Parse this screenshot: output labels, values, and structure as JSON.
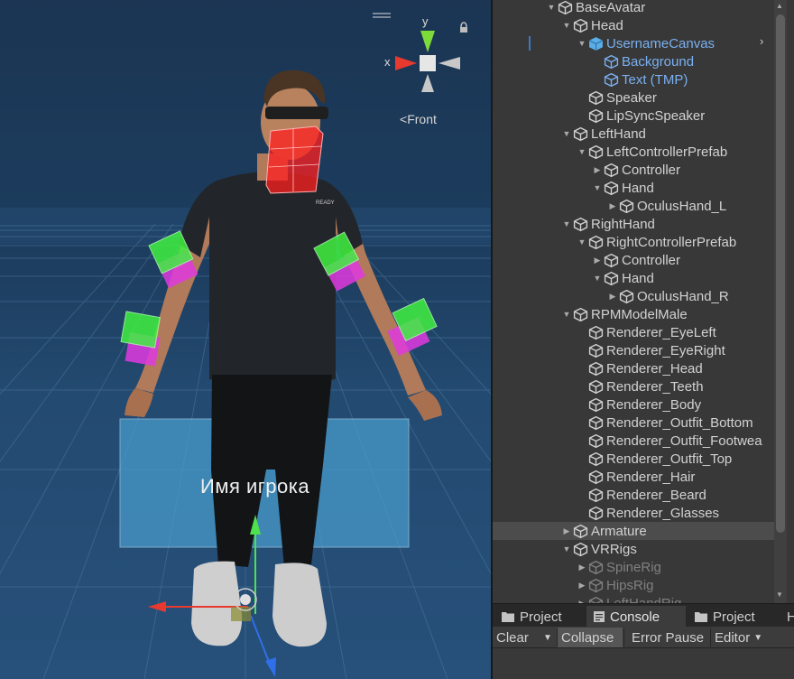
{
  "scene": {
    "orientation_label": "Front",
    "axis_y": "y",
    "axis_x": "x",
    "canvas_text": "Имя игрока",
    "lock_icon": "lock-icon",
    "menu_icon": "hamburger-icon"
  },
  "hierarchy": {
    "items": [
      {
        "label": "BaseAvatar",
        "fold": "open",
        "color": "normal"
      },
      {
        "label": "Head",
        "fold": "open",
        "color": "normal"
      },
      {
        "label": "UsernameCanvas",
        "fold": "open",
        "color": "blue",
        "icon": "prefab"
      },
      {
        "label": "Background",
        "fold": "none",
        "color": "blue"
      },
      {
        "label": "Text (TMP)",
        "fold": "none",
        "color": "blue"
      },
      {
        "label": "Speaker",
        "fold": "none",
        "color": "normal"
      },
      {
        "label": "LipSyncSpeaker",
        "fold": "none",
        "color": "normal"
      },
      {
        "label": "LeftHand",
        "fold": "open",
        "color": "normal"
      },
      {
        "label": "LeftControllerPrefab",
        "fold": "open",
        "color": "normal"
      },
      {
        "label": "Controller",
        "fold": "closed",
        "color": "normal"
      },
      {
        "label": "Hand",
        "fold": "open",
        "color": "normal"
      },
      {
        "label": "OculusHand_L",
        "fold": "closed",
        "color": "normal"
      },
      {
        "label": "RightHand",
        "fold": "open",
        "color": "normal"
      },
      {
        "label": "RightControllerPrefab",
        "fold": "open",
        "color": "normal"
      },
      {
        "label": "Controller",
        "fold": "closed",
        "color": "normal"
      },
      {
        "label": "Hand",
        "fold": "open",
        "color": "normal"
      },
      {
        "label": "OculusHand_R",
        "fold": "closed",
        "color": "normal"
      },
      {
        "label": "RPMModelMale",
        "fold": "open",
        "color": "normal"
      },
      {
        "label": "Renderer_EyeLeft",
        "fold": "none",
        "color": "normal"
      },
      {
        "label": "Renderer_EyeRight",
        "fold": "none",
        "color": "normal"
      },
      {
        "label": "Renderer_Head",
        "fold": "none",
        "color": "normal"
      },
      {
        "label": "Renderer_Teeth",
        "fold": "none",
        "color": "normal"
      },
      {
        "label": "Renderer_Body",
        "fold": "none",
        "color": "normal"
      },
      {
        "label": "Renderer_Outfit_Bottom",
        "fold": "none",
        "color": "normal"
      },
      {
        "label": "Renderer_Outfit_Footwea",
        "fold": "none",
        "color": "normal"
      },
      {
        "label": "Renderer_Outfit_Top",
        "fold": "none",
        "color": "normal"
      },
      {
        "label": "Renderer_Hair",
        "fold": "none",
        "color": "normal"
      },
      {
        "label": "Renderer_Beard",
        "fold": "none",
        "color": "normal"
      },
      {
        "label": "Renderer_Glasses",
        "fold": "none",
        "color": "normal"
      },
      {
        "label": "Armature",
        "fold": "closed",
        "color": "normal",
        "selected": true
      },
      {
        "label": "VRRigs",
        "fold": "open",
        "color": "normal"
      },
      {
        "label": "SpineRig",
        "fold": "closed",
        "color": "gray"
      },
      {
        "label": "HipsRig",
        "fold": "closed",
        "color": "gray"
      },
      {
        "label": "LeftHandRig",
        "fold": "closed",
        "color": "gray"
      }
    ]
  },
  "tabs": [
    {
      "label": "Project",
      "icon": "folder-icon",
      "active": false
    },
    {
      "label": "Console",
      "icon": "console-icon",
      "active": true
    },
    {
      "label": "Project",
      "icon": "folder-icon",
      "active": false
    },
    {
      "label": "H",
      "icon": "",
      "active": false
    }
  ],
  "console_toolbar": {
    "clear": "Clear",
    "collapse": "Collapse",
    "error_pause": "Error Pause",
    "editor": "Editor"
  },
  "colors": {
    "selection_blue": "#7ab0f0",
    "collider_green": "#39f03a",
    "collider_magenta": "#e436e4",
    "face_red": "#ff2020"
  }
}
